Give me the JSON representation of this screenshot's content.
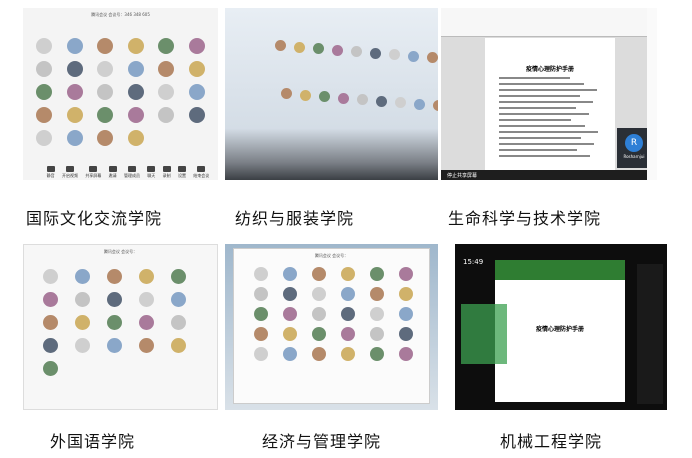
{
  "panels": [
    {
      "id": "p1",
      "caption": "国际文化交流学院",
      "meeting_title": "腾讯会议 会议号：346 348 605",
      "participants": [
        "",
        "",
        "",
        "",
        "",
        "",
        "",
        "",
        "",
        "",
        "",
        "",
        "",
        "",
        "",
        "",
        "",
        "",
        "",
        "",
        "",
        "",
        "",
        "",
        "",
        "",
        "",
        ""
      ],
      "toolbar": [
        "静音",
        "开启视频",
        "共享屏幕",
        "邀请",
        "管理成员",
        "聊天",
        "录制",
        "设置",
        "结束会议"
      ]
    },
    {
      "id": "p2",
      "caption": "纺织与服装学院"
    },
    {
      "id": "p3",
      "caption": "生命科学与技术学院",
      "doc_heading": "疫情心理防护手册",
      "presenter_initial": "R",
      "presenter_name": "Rosharnjui",
      "taskbar_text": "停止共享屏幕"
    },
    {
      "id": "p4",
      "caption": "外国语学院",
      "meeting_title": "腾讯会议 会议号：",
      "participants": [
        "",
        "",
        "",
        "",
        "",
        "",
        "",
        "",
        "",
        "",
        "",
        "",
        "",
        "",
        "",
        "",
        "",
        "",
        "",
        "",
        ""
      ]
    },
    {
      "id": "p5",
      "caption": "经济与管理学院",
      "meeting_title": "腾讯会议 会议号：",
      "participants": [
        "",
        "",
        "",
        "",
        "",
        "",
        "",
        "",
        "",
        "",
        "",
        "",
        "",
        "",
        "",
        "",
        "",
        "",
        "",
        "",
        "",
        "",
        "",
        "",
        "",
        "",
        "",
        "",
        "",
        ""
      ]
    },
    {
      "id": "p6",
      "caption": "机械工程学院",
      "doc_heading": "疫情心理防护手册",
      "time_text": "15:49"
    }
  ],
  "colors": {
    "caption": "#111111",
    "desktop_blue": "#2d6fb5"
  }
}
